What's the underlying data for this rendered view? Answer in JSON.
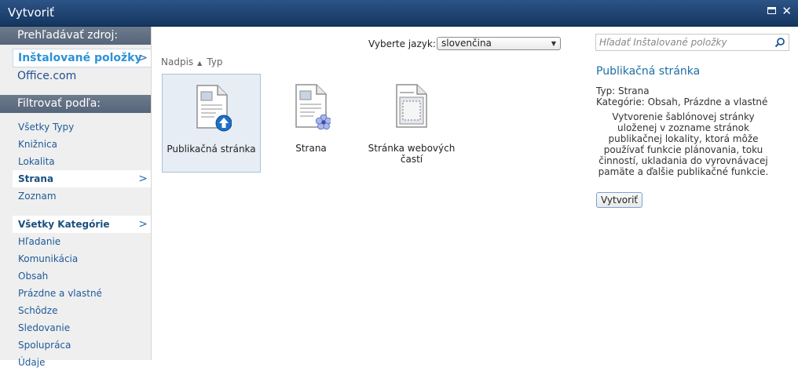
{
  "window": {
    "title": "Vytvoriť"
  },
  "sidebar": {
    "browse_heading": "Prehľadávať zdroj:",
    "sources": [
      "Inštalované položky",
      "Office.com"
    ],
    "filter_heading": "Filtrovať podľa:",
    "types": [
      "Všetky Typy",
      "Knižnica",
      "Lokalita",
      "Strana",
      "Zoznam"
    ],
    "categories": [
      "Všetky Kategórie",
      "Hľadanie",
      "Komunikácia",
      "Obsah",
      "Prázdne a vlastné",
      "Schôdze",
      "Sledovanie",
      "Spolupráca",
      "Údaje"
    ]
  },
  "toolbar": {
    "language_label": "Vyberte jazyk:",
    "language_value": "slovenčina",
    "sort_title": "Nadpis",
    "sort_type": "Typ"
  },
  "tiles": [
    {
      "label": "Publikačná stránka",
      "icon": "publishing-page-icon"
    },
    {
      "label": "Strana",
      "icon": "page-template-icon"
    },
    {
      "label": "Stránka webových častí",
      "icon": "web-part-page-icon"
    }
  ],
  "detail": {
    "search_placeholder": "Hľadať Inštalované položky",
    "title": "Publikačná stránka",
    "type_line": "Typ: Strana",
    "category_line": "Kategórie: Obsah, Prázdne a vlastné",
    "description": "Vytvorenie šablónovej stránky uloženej v zozname stránok publikačnej lokality, ktorá môže používať funkcie plánovania, toku činností, ukladania do vyrovnávacej pamäte a ďalšie publikačné funkcie.",
    "create_button": "Vytvoriť"
  },
  "colors": {
    "titlebar": "#1f4370",
    "accent": "#1c6ea4",
    "selected_source": "#2b92d8"
  }
}
